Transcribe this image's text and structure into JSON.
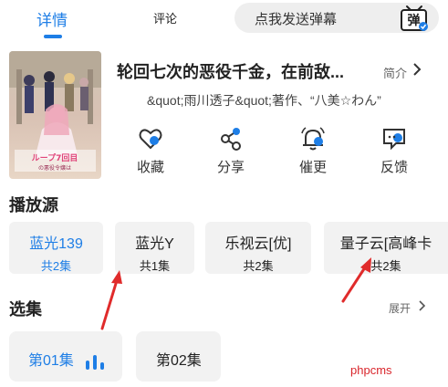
{
  "tabs": {
    "detail": "详情",
    "comment": "评论"
  },
  "danmu": {
    "placeholder": "点我发送弹幕",
    "icon_char": "弹"
  },
  "show": {
    "title": "轮回七次的恶役千金，在前敌...",
    "intro_label": "简介",
    "authors": "&quot;雨川透子&quot;著作、“八美☆わん”",
    "poster_text_top": "ループ7回目",
    "poster_text_bottom": "の悪役令嬢は"
  },
  "actions": [
    {
      "label": "收藏",
      "icon": "favorite-heart-icon"
    },
    {
      "label": "分享",
      "icon": "share-icon"
    },
    {
      "label": "催更",
      "icon": "bell-icon"
    },
    {
      "label": "反馈",
      "icon": "feedback-icon"
    }
  ],
  "sources": {
    "title": "播放源",
    "items": [
      {
        "name": "蓝光139",
        "count": "共2集",
        "selected": true
      },
      {
        "name": "蓝光Y",
        "count": "共1集",
        "selected": false
      },
      {
        "name": "乐视云[优]",
        "count": "共2集",
        "selected": false
      },
      {
        "name": "量子云[高峰卡",
        "count": "共2集",
        "selected": false
      }
    ]
  },
  "episodes": {
    "title": "选集",
    "expand_label": "展开",
    "items": [
      {
        "label": "第01集",
        "playing": true
      },
      {
        "label": "第02集",
        "playing": false
      }
    ]
  },
  "watermark": "phpcms",
  "colors": {
    "accent": "#1e7ee6",
    "annotation": "#e02b2b",
    "chip_bg": "#f2f2f2"
  }
}
